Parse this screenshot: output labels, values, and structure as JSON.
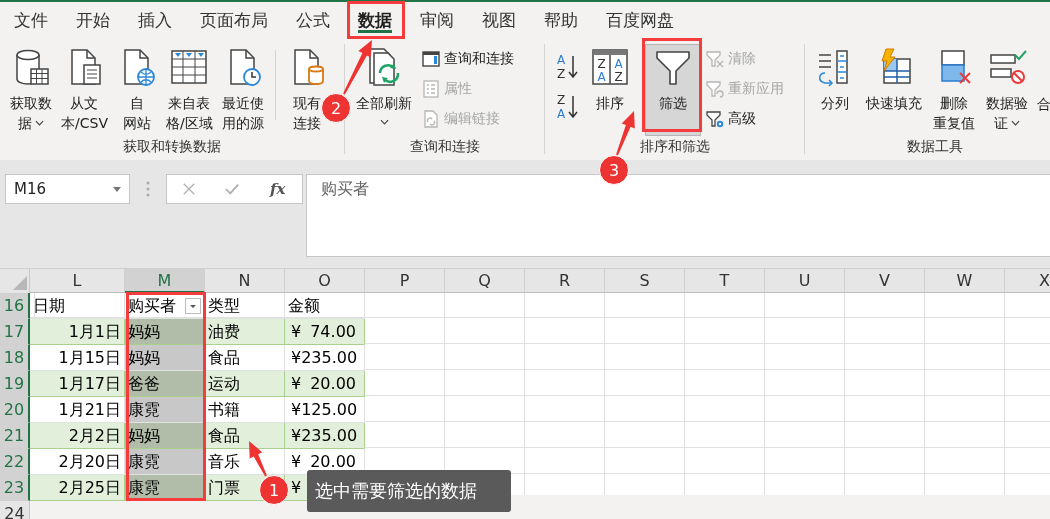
{
  "tabs": [
    {
      "label": "文件",
      "selected": false
    },
    {
      "label": "开始",
      "selected": false
    },
    {
      "label": "插入",
      "selected": false
    },
    {
      "label": "页面布局",
      "selected": false
    },
    {
      "label": "公式",
      "selected": false
    },
    {
      "label": "数据",
      "selected": true
    },
    {
      "label": "审阅",
      "selected": false
    },
    {
      "label": "视图",
      "selected": false
    },
    {
      "label": "帮助",
      "selected": false
    },
    {
      "label": "百度网盘",
      "selected": false
    }
  ],
  "ribbon": {
    "groups": [
      {
        "label": "获取和转换数据",
        "items": [
          {
            "kind": "large",
            "lines": [
              "获取数",
              "据"
            ],
            "dropdown": true,
            "pressed": false
          },
          {
            "kind": "large",
            "lines": [
              "从文",
              "本/CSV"
            ],
            "pressed": false
          },
          {
            "kind": "large",
            "lines": [
              "自",
              "网站"
            ],
            "pressed": false
          },
          {
            "kind": "large",
            "lines": [
              "来自表",
              "格/区域"
            ],
            "pressed": false
          },
          {
            "kind": "large",
            "lines": [
              "最近使",
              "用的源"
            ],
            "pressed": false
          },
          {
            "kind": "separator"
          },
          {
            "kind": "large",
            "lines": [
              "现有",
              "连接"
            ],
            "pressed": false
          }
        ]
      },
      {
        "label": "查询和连接",
        "items": [
          {
            "kind": "large",
            "lines": [
              "全部刷新"
            ],
            "dropdown": true,
            "pressed": false
          },
          {
            "kind": "small",
            "label": "查询和连接",
            "disabled": false
          },
          {
            "kind": "small",
            "label": "属性",
            "disabled": true
          },
          {
            "kind": "small",
            "label": "编辑链接",
            "disabled": true
          }
        ]
      },
      {
        "label": "排序和筛选",
        "items": [
          {
            "kind": "sort",
            "letters": [
              "A",
              "Z"
            ]
          },
          {
            "kind": "sort",
            "letters": [
              "Z",
              "A"
            ]
          },
          {
            "kind": "large",
            "lines": [
              "排序"
            ],
            "letters": [
              "Z",
              "A",
              "A",
              "Z"
            ],
            "pressed": false
          },
          {
            "kind": "large",
            "lines": [
              "筛选"
            ],
            "pressed": true
          },
          {
            "kind": "small",
            "label": "清除",
            "disabled": true
          },
          {
            "kind": "small",
            "label": "重新应用",
            "disabled": true
          },
          {
            "kind": "small",
            "label": "高级",
            "disabled": false
          }
        ]
      },
      {
        "label": "数据工具",
        "items": [
          {
            "kind": "large",
            "lines": [
              "分列"
            ],
            "pressed": false
          },
          {
            "kind": "large",
            "lines": [
              "快速填充"
            ],
            "pressed": false
          },
          {
            "kind": "large",
            "lines": [
              "删除",
              "重复值"
            ],
            "pressed": false
          },
          {
            "kind": "large",
            "lines": [
              "数据验",
              "证"
            ],
            "dropdown": true,
            "pressed": false
          },
          {
            "kind": "cut",
            "lines": [
              "合"
            ]
          }
        ]
      }
    ]
  },
  "formula_bar": {
    "name_box": "M16",
    "fx": "fx",
    "content": "购买者"
  },
  "columns": [
    {
      "label": "L",
      "selected": false
    },
    {
      "label": "M",
      "selected": true
    },
    {
      "label": "N",
      "selected": false
    },
    {
      "label": "O",
      "selected": false
    },
    {
      "label": "P",
      "selected": false
    },
    {
      "label": "Q",
      "selected": false
    },
    {
      "label": "R",
      "selected": false
    },
    {
      "label": "S",
      "selected": false
    },
    {
      "label": "T",
      "selected": false
    },
    {
      "label": "U",
      "selected": false
    },
    {
      "label": "V",
      "selected": false
    },
    {
      "label": "W",
      "selected": false
    },
    {
      "label": "X",
      "selected": false
    }
  ],
  "rows": [
    {
      "number": "16",
      "selected": true,
      "kind": "header",
      "labels": [
        {
          "text": "日期"
        },
        {
          "text": "购买者",
          "filter": true
        },
        {
          "text": "类型"
        },
        {
          "text": "金额"
        }
      ]
    },
    {
      "number": "17",
      "selected": true,
      "kind": "data",
      "banded": true,
      "date": "1月1日",
      "buyer": "妈妈",
      "category": "油费",
      "symbol": "¥",
      "amount": "74.00"
    },
    {
      "number": "18",
      "selected": true,
      "kind": "data",
      "banded": false,
      "date": "1月15日",
      "buyer": "妈妈",
      "category": "食品",
      "symbol": "¥",
      "amount": "235.00"
    },
    {
      "number": "19",
      "selected": true,
      "kind": "data",
      "banded": true,
      "date": "1月17日",
      "buyer": "爸爸",
      "category": "运动",
      "symbol": "¥",
      "amount": "20.00"
    },
    {
      "number": "20",
      "selected": true,
      "kind": "data",
      "banded": false,
      "date": "1月21日",
      "buyer": "康霓",
      "category": "书籍",
      "symbol": "¥",
      "amount": "125.00"
    },
    {
      "number": "21",
      "selected": true,
      "kind": "data",
      "banded": true,
      "date": "2月2日",
      "buyer": "妈妈",
      "category": "食品",
      "symbol": "¥",
      "amount": "235.00"
    },
    {
      "number": "22",
      "selected": true,
      "kind": "data",
      "banded": false,
      "date": "2月20日",
      "buyer": "康霓",
      "category": "音乐",
      "symbol": "¥",
      "amount": "20.00"
    },
    {
      "number": "23",
      "selected": true,
      "kind": "data",
      "banded": true,
      "date": "2月25日",
      "buyer": "康霓",
      "category": "门票",
      "symbol": "¥"
    },
    {
      "number": "24",
      "selected": false,
      "kind": "empty"
    }
  ],
  "callouts": [
    {
      "number": "1",
      "text": "选中需要筛选的数据"
    },
    {
      "number": "2"
    },
    {
      "number": "3"
    }
  ]
}
